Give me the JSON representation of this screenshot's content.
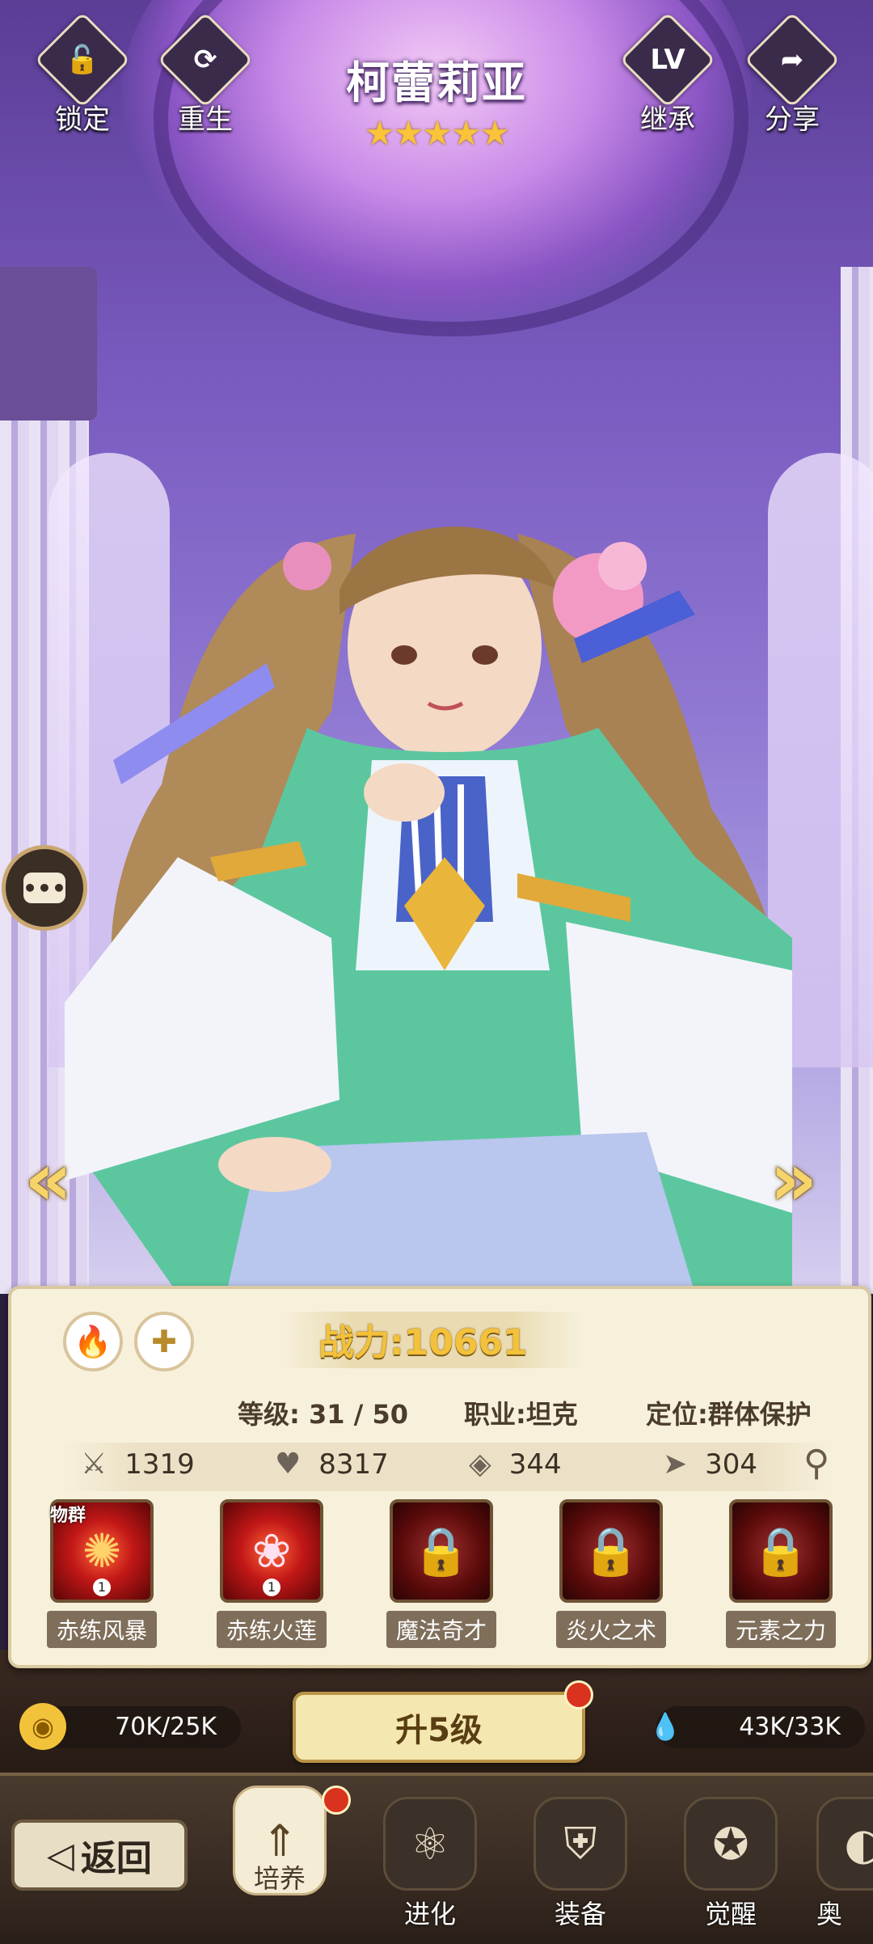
{
  "header": {
    "title": "柯蕾莉亚",
    "stars": "★★★★★",
    "buttons": [
      {
        "label": "锁定",
        "glyph": "🔓"
      },
      {
        "label": "重生",
        "glyph": "⟳"
      },
      {
        "label": "继承",
        "glyph": "LV"
      },
      {
        "label": "分享",
        "glyph": "➦"
      }
    ]
  },
  "nav": {
    "prev_glyph": "«",
    "next_glyph": "»",
    "chat_glyph": "•••"
  },
  "panel": {
    "element_glyph": "🔥",
    "class_glyph": "✚",
    "power_text": "战力:10661",
    "level_text": "等级: 31 / 50",
    "job_text": "职业:坦克",
    "role_text": "定位:群体保护",
    "stats": [
      {
        "icon": "attack-icon",
        "glyph": "⚔",
        "value": "1319"
      },
      {
        "icon": "health-icon",
        "glyph": "♥",
        "value": "8317"
      },
      {
        "icon": "defense-icon",
        "glyph": "◈",
        "value": "344"
      },
      {
        "icon": "speed-icon",
        "glyph": "➤",
        "value": "304"
      }
    ],
    "skills": [
      {
        "name": "赤练风暴",
        "tag": "物群",
        "level": "1",
        "locked": false,
        "glyph": "✺"
      },
      {
        "name": "赤练火莲",
        "tag": "",
        "level": "1",
        "locked": false,
        "glyph": "❀"
      },
      {
        "name": "魔法奇才",
        "tag": "",
        "level": "",
        "locked": true,
        "glyph": "🔒"
      },
      {
        "name": "炎火之术",
        "tag": "",
        "level": "",
        "locked": true,
        "glyph": "🔒"
      },
      {
        "name": "元素之力",
        "tag": "",
        "level": "",
        "locked": true,
        "glyph": "🔒"
      }
    ]
  },
  "resources": {
    "gold": "70K/25K",
    "essence": "43K/33K",
    "gold_glyph": "◉",
    "essence_glyph": "💧"
  },
  "levelup_label": "升5级",
  "bottom_nav": {
    "back_label": "返回",
    "tabs": [
      {
        "label": "培养",
        "glyph": "⇑"
      },
      {
        "label": "进化",
        "glyph": "⚛"
      },
      {
        "label": "装备",
        "glyph": "⛨"
      },
      {
        "label": "觉醒",
        "glyph": "✪"
      },
      {
        "label": "奥",
        "glyph": "◐"
      }
    ]
  },
  "colors": {
    "accent_gold": "#f3c13a",
    "panel_bg": "#f7f1dc",
    "notify_red": "#d9321f"
  }
}
